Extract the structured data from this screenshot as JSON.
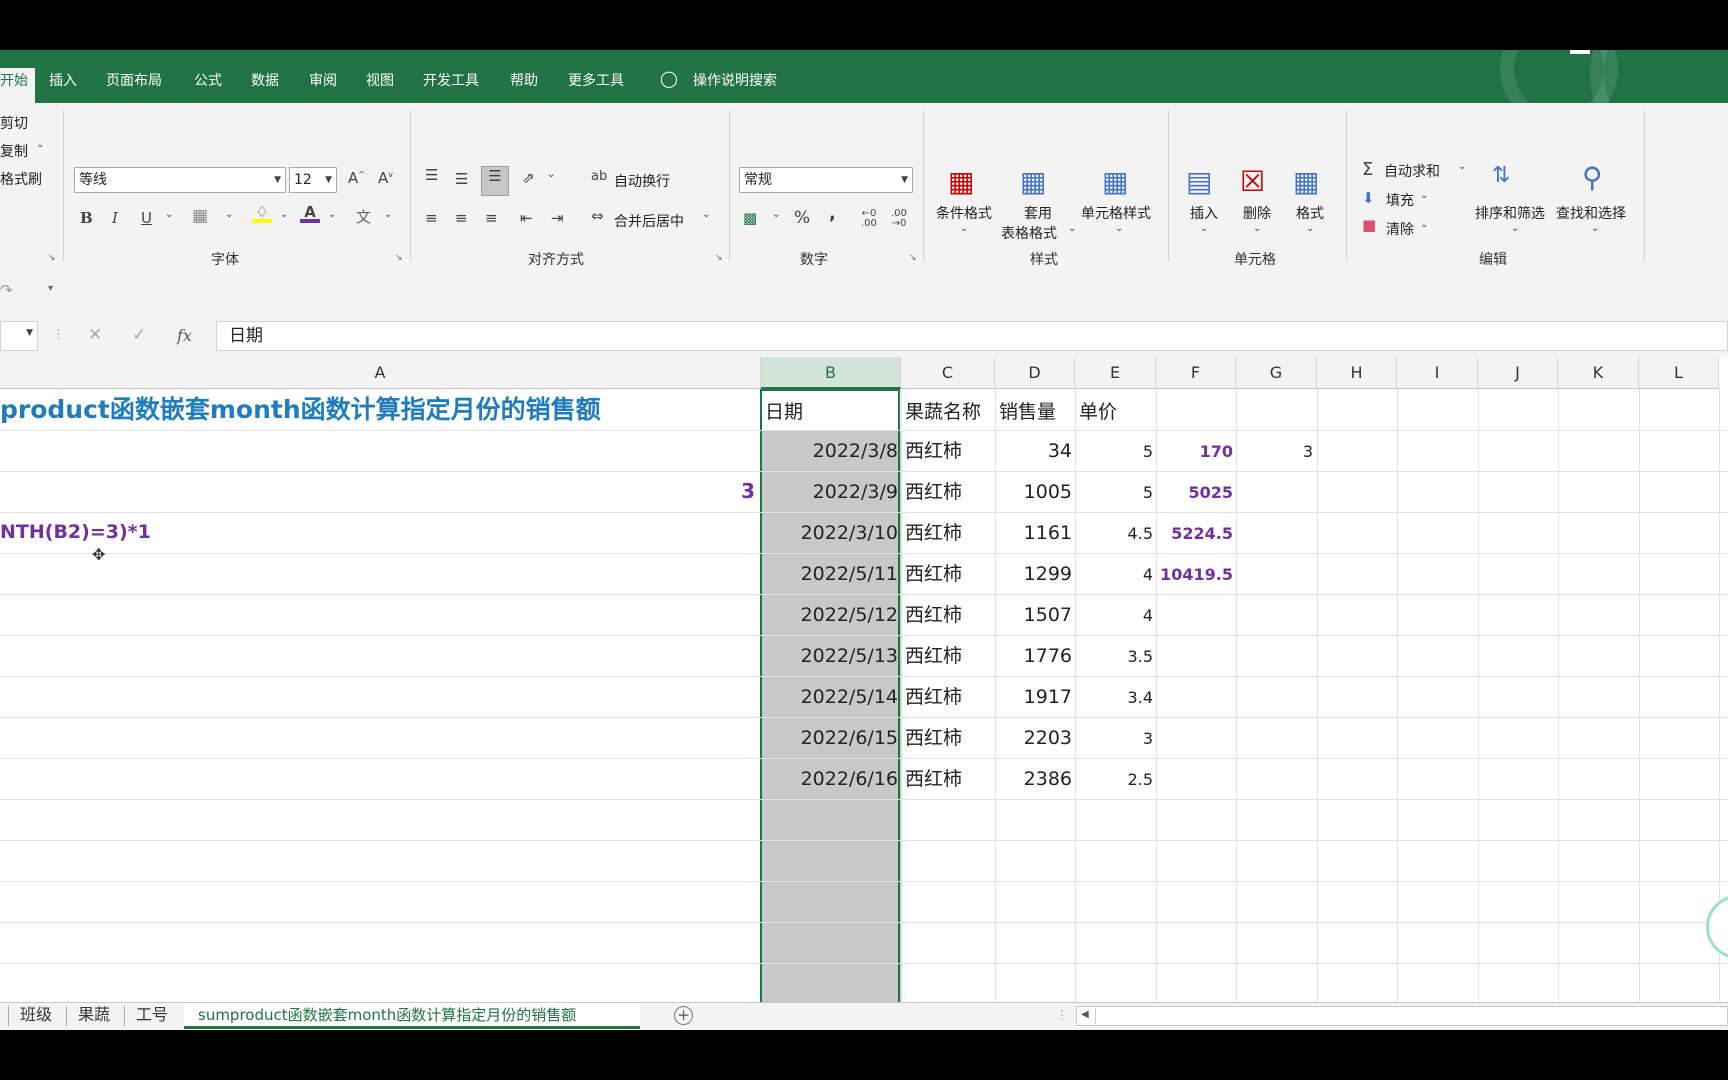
{
  "tabs": [
    "开始",
    "插入",
    "页面布局",
    "公式",
    "数据",
    "审阅",
    "视图",
    "开发工具",
    "帮助",
    "更多工具"
  ],
  "tell_me": "操作说明搜索",
  "clipboard": {
    "cut": "剪切",
    "copy": "复制",
    "format_painter": "格式刷"
  },
  "font": {
    "name": "等线",
    "size": "12",
    "group": "字体",
    "bold": "B",
    "italic": "I",
    "underline": "U",
    "font_color_label": "A"
  },
  "alignment": {
    "wrap": "自动换行",
    "merge": "合并后居中",
    "group": "对齐方式"
  },
  "number": {
    "format": "常规",
    "group": "数字",
    "percent": "%",
    "comma": ","
  },
  "styles": {
    "conditional": "条件格式",
    "table_line1": "套用",
    "table_line2": "表格格式",
    "cell_styles": "单元格样式",
    "group": "样式"
  },
  "cells": {
    "insert": "插入",
    "delete": "删除",
    "format": "格式",
    "group": "单元格"
  },
  "editing": {
    "autosum": "自动求和",
    "fill": "填充",
    "clear": "清除",
    "sort": "排序和筛选",
    "find": "查找和选择",
    "group": "编辑"
  },
  "formula_bar": {
    "fx": "fx",
    "content": "日期"
  },
  "columns": [
    "A",
    "B",
    "C",
    "D",
    "E",
    "F",
    "G",
    "H",
    "I",
    "J",
    "K",
    "L"
  ],
  "sheet": {
    "title": "product函数嵌套month函数计算指定月份的销售额",
    "a3_value": "3",
    "a4_formula": "NTH(B2)=3)*1",
    "headers": {
      "date": "日期",
      "name": "果蔬名称",
      "qty": "销售量",
      "price": "单价"
    },
    "rows": [
      {
        "date": "2022/3/8",
        "name": "西红柿",
        "qty": "34",
        "price": "5",
        "f": "170",
        "g": "3"
      },
      {
        "date": "2022/3/9",
        "name": "西红柿",
        "qty": "1005",
        "price": "5",
        "f": "5025",
        "g": ""
      },
      {
        "date": "2022/3/10",
        "name": "西红柿",
        "qty": "1161",
        "price": "4.5",
        "f": "5224.5",
        "g": ""
      },
      {
        "date": "2022/5/11",
        "name": "西红柿",
        "qty": "1299",
        "price": "4",
        "f": "10419.5",
        "g": ""
      },
      {
        "date": "2022/5/12",
        "name": "西红柿",
        "qty": "1507",
        "price": "4",
        "f": "",
        "g": ""
      },
      {
        "date": "2022/5/13",
        "name": "西红柿",
        "qty": "1776",
        "price": "3.5",
        "f": "",
        "g": ""
      },
      {
        "date": "2022/5/14",
        "name": "西红柿",
        "qty": "1917",
        "price": "3.4",
        "f": "",
        "g": ""
      },
      {
        "date": "2022/6/15",
        "name": "西红柿",
        "qty": "2203",
        "price": "3",
        "f": "",
        "g": ""
      },
      {
        "date": "2022/6/16",
        "name": "西红柿",
        "qty": "2386",
        "price": "2.5",
        "f": "",
        "g": ""
      }
    ]
  },
  "sheet_tabs": [
    "班级",
    "果蔬",
    "工号",
    "sumproduct函数嵌套month函数计算指定月份的销售额"
  ],
  "colors": {
    "excel_green": "#217346",
    "purple": "#7030a0",
    "title_blue": "#1f7dbe",
    "selected_column": "#c8c8c8"
  }
}
